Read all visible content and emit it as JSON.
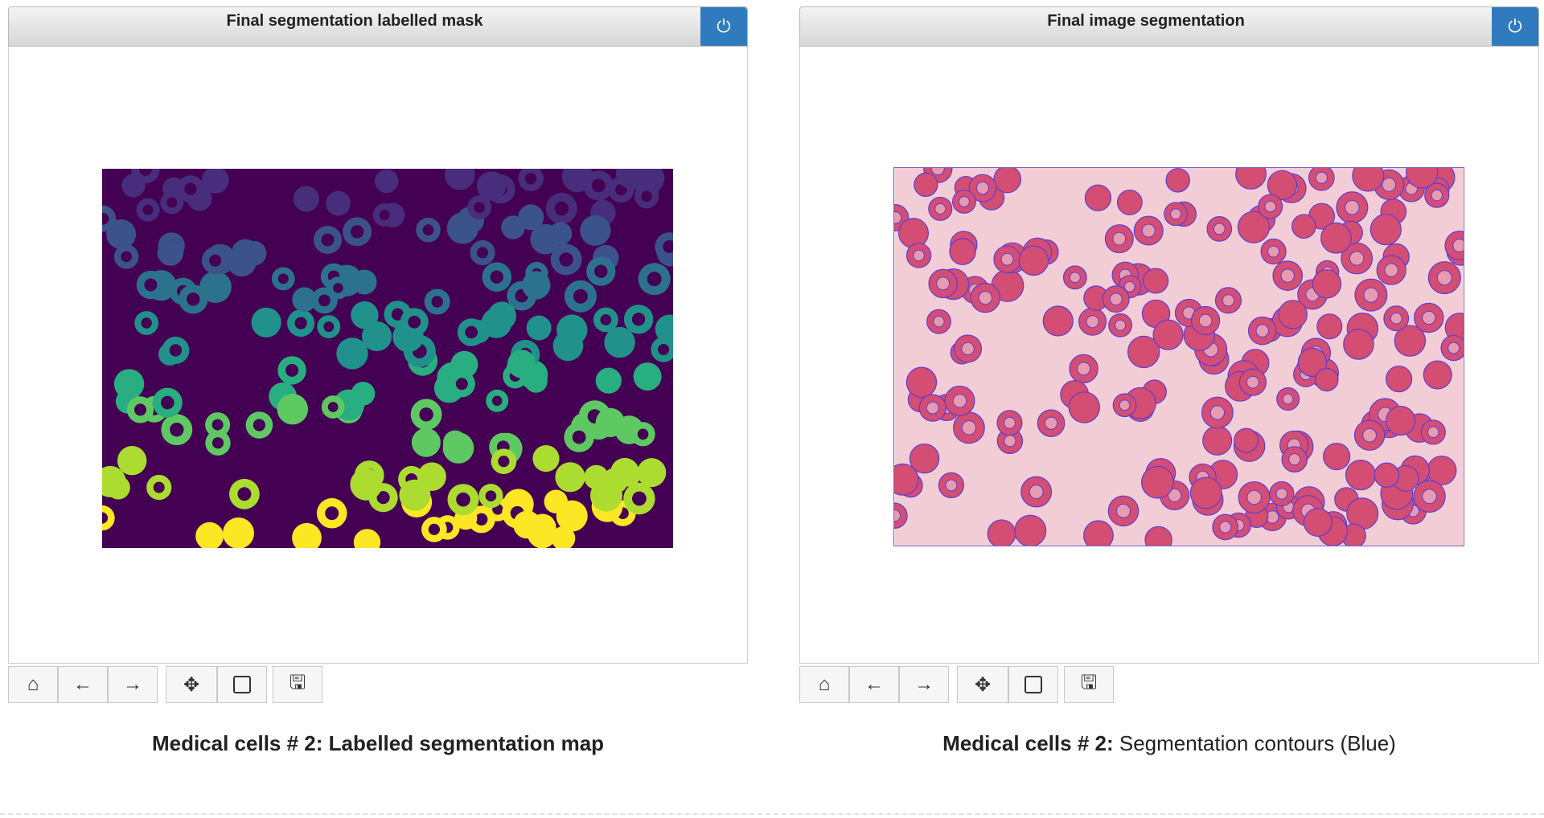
{
  "panels": [
    {
      "title": "Final segmentation labelled mask",
      "caption_bold": "Medical cells # 2:",
      "caption_rest": "Labelled segmentation map"
    },
    {
      "title": "Final image segmentation",
      "caption_bold": "Medical cells # 2:",
      "caption_rest": "Segmentation contours (Blue)"
    }
  ],
  "toolbar": {
    "icons": [
      "home-icon",
      "back-arrow-icon",
      "forward-arrow-icon",
      "pan-move-icon",
      "zoom-rect-icon",
      "save-icon"
    ]
  },
  "colors": {
    "close_button": "#2f7bbd",
    "mask_background": "#440154",
    "cell_pink": "#d44d73",
    "background_pink": "#f3cdd6",
    "contour_blue": "#5a3fd6"
  }
}
